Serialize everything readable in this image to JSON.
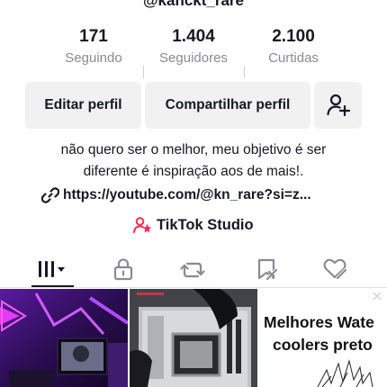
{
  "profile": {
    "username": "@kanckt_rare",
    "stats": [
      {
        "value": "171",
        "label": "Seguindo"
      },
      {
        "value": "1.404",
        "label": "Seguidores"
      },
      {
        "value": "2.100",
        "label": "Curtidas"
      }
    ],
    "buttons": {
      "edit": "Editar perfil",
      "share": "Compartilhar perfil",
      "add_friend_icon": "person-plus-icon"
    },
    "bio": {
      "line1": "não quero ser o melhor, meu objetivo é ser",
      "line2": "diferente é inspiração aos de mais!."
    },
    "link": {
      "text": "https://youtube.com/@kn_rare?si=z...",
      "icon": "link-icon"
    },
    "studio": {
      "text": "TikTok Studio",
      "icon": "creator-icon",
      "icon_color": "#fe2c55"
    }
  },
  "tabs": [
    {
      "name": "videos",
      "icon": "grid-icon",
      "active": true
    },
    {
      "name": "private",
      "icon": "lock-icon"
    },
    {
      "name": "reposts",
      "icon": "repost-icon"
    },
    {
      "name": "favorites",
      "icon": "bookmark-icon"
    },
    {
      "name": "liked",
      "icon": "heart-icon"
    }
  ],
  "videos": [
    {
      "type": "image",
      "description_icon": "purple-setup-thumbnail"
    },
    {
      "type": "image",
      "description_icon": "motherboard-thumbnail"
    },
    {
      "type": "text",
      "title_line1": "Melhores Wate",
      "title_line2": "coolers preto"
    }
  ],
  "colors": {
    "text": "#161823",
    "secondary": "#8a8b91",
    "button_bg": "#f1f1f2",
    "accent": "#fe2c55"
  }
}
